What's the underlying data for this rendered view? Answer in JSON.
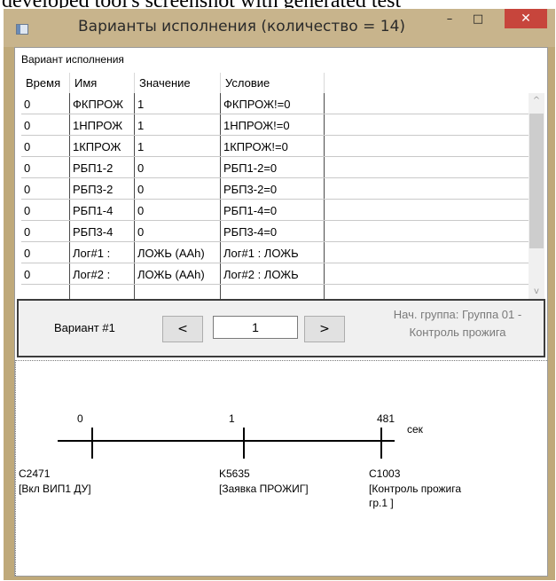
{
  "caption_top": "developed tool's screenshot with generated test",
  "window": {
    "title": "Варианты исполнения (количество = 14)",
    "minimize_glyph": "–",
    "maximize_glyph": "□",
    "close_glyph": "✕"
  },
  "group": {
    "caption": "Вариант исполнения"
  },
  "table": {
    "columns": [
      "Время",
      "Имя",
      "Значение",
      "Условие"
    ],
    "rows": [
      [
        "0",
        "ФКПРОЖ",
        "1",
        "ФКПРОЖ!=0"
      ],
      [
        "0",
        "1НПРОЖ",
        "1",
        "1НПРОЖ!=0"
      ],
      [
        "0",
        "1КПРОЖ",
        "1",
        "1КПРОЖ!=0"
      ],
      [
        "0",
        "РБП1-2",
        "0",
        "РБП1-2=0"
      ],
      [
        "0",
        "РБП3-2",
        "0",
        "РБП3-2=0"
      ],
      [
        "0",
        "РБП1-4",
        "0",
        "РБП1-4=0"
      ],
      [
        "0",
        "РБП3-4",
        "0",
        "РБП3-4=0"
      ],
      [
        "0",
        "Лог#1 :",
        "ЛОЖЬ (AAh)",
        "Лог#1 : ЛОЖЬ"
      ],
      [
        "0",
        "Лог#2 :",
        "ЛОЖЬ (AAh)",
        "Лог#2 : ЛОЖЬ"
      ],
      [
        "",
        "",
        "",
        ""
      ]
    ]
  },
  "scroll": {
    "up_glyph": "^",
    "down_glyph": "v"
  },
  "nav": {
    "variant_label": "Вариант #1",
    "prev_label": "<",
    "page_value": "1",
    "next_label": ">",
    "group_line1": "Нач. группа: Группа 01 -",
    "group_line2": "Контроль прожига"
  },
  "timeline": {
    "unit": "сек",
    "events": [
      {
        "time": "0",
        "code": "C2471",
        "desc1": "[Вкл ВИП1 ДУ]",
        "desc2": ""
      },
      {
        "time": "1",
        "code": "K5635",
        "desc1": "[Заявка ПРОЖИГ]",
        "desc2": ""
      },
      {
        "time": "481",
        "code": "C1003",
        "desc1": "[Контроль прожига",
        "desc2": "гр.1 ]"
      }
    ]
  }
}
